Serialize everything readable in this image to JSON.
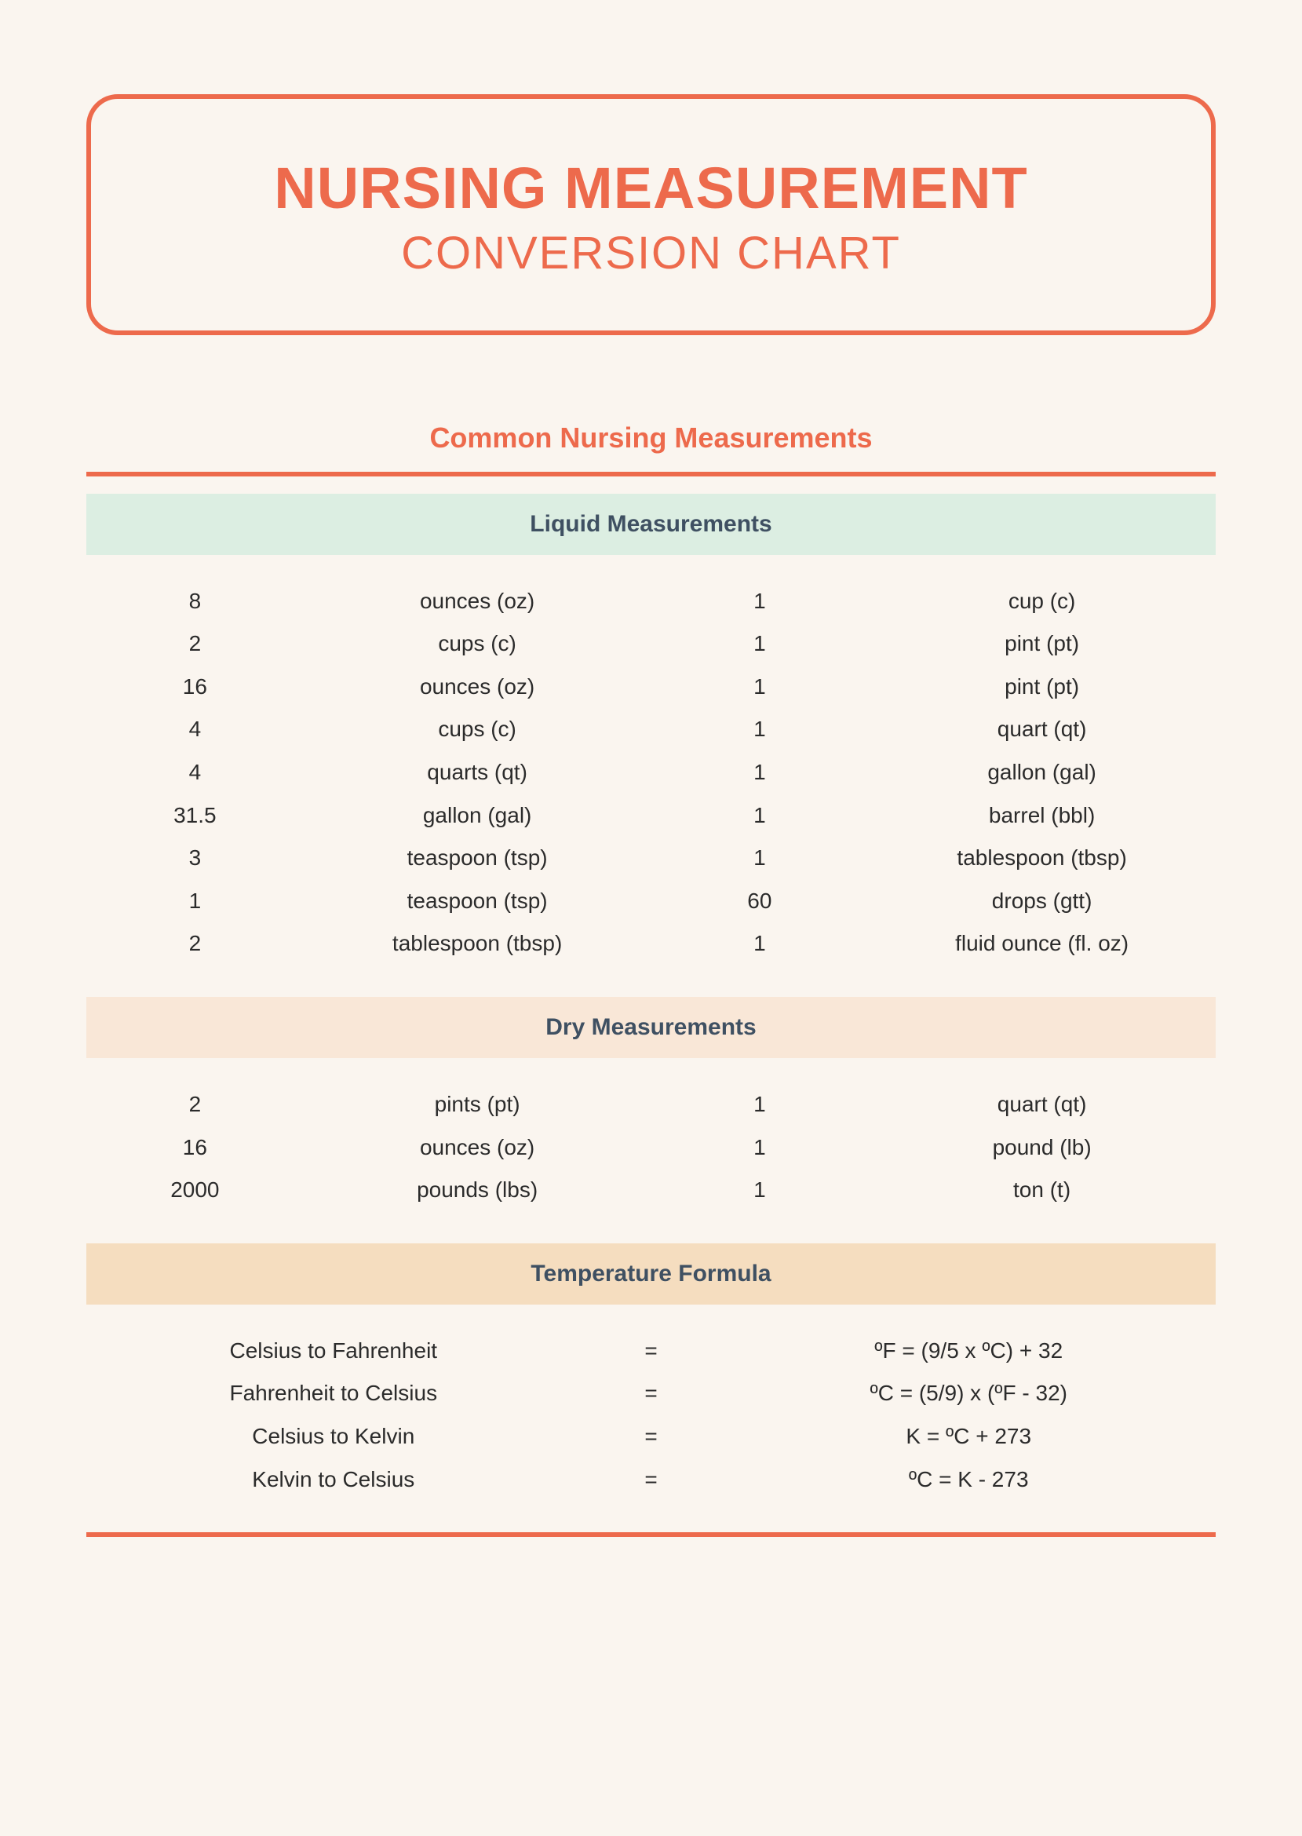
{
  "header": {
    "title_main": "NURSING MEASUREMENT",
    "title_sub": "CONVERSION CHART"
  },
  "section_heading": "Common Nursing Measurements",
  "sections": {
    "liquid": {
      "label": "Liquid Measurements",
      "rows": [
        {
          "a": "8",
          "au": "ounces (oz)",
          "b": "1",
          "bu": "cup (c)"
        },
        {
          "a": "2",
          "au": "cups (c)",
          "b": "1",
          "bu": "pint (pt)"
        },
        {
          "a": "16",
          "au": "ounces (oz)",
          "b": "1",
          "bu": "pint (pt)"
        },
        {
          "a": "4",
          "au": "cups (c)",
          "b": "1",
          "bu": "quart (qt)"
        },
        {
          "a": "4",
          "au": "quarts (qt)",
          "b": "1",
          "bu": "gallon (gal)"
        },
        {
          "a": "31.5",
          "au": "gallon (gal)",
          "b": "1",
          "bu": "barrel (bbl)"
        },
        {
          "a": "3",
          "au": "teaspoon (tsp)",
          "b": "1",
          "bu": "tablespoon (tbsp)"
        },
        {
          "a": "1",
          "au": "teaspoon (tsp)",
          "b": "60",
          "bu": "drops (gtt)"
        },
        {
          "a": "2",
          "au": "tablespoon (tbsp)",
          "b": "1",
          "bu": "fluid ounce (fl. oz)"
        }
      ]
    },
    "dry": {
      "label": "Dry Measurements",
      "rows": [
        {
          "a": "2",
          "au": "pints (pt)",
          "b": "1",
          "bu": "quart (qt)"
        },
        {
          "a": "16",
          "au": "ounces (oz)",
          "b": "1",
          "bu": "pound (lb)"
        },
        {
          "a": "2000",
          "au": "pounds (lbs)",
          "b": "1",
          "bu": "ton (t)"
        }
      ]
    },
    "temperature": {
      "label": "Temperature Formula",
      "rows": [
        {
          "name": "Celsius to Fahrenheit",
          "eq": "=",
          "formula": "ºF = (9/5 x ºC) + 32"
        },
        {
          "name": "Fahrenheit to Celsius",
          "eq": "=",
          "formula": "ºC = (5/9) x (ºF - 32)"
        },
        {
          "name": "Celsius to Kelvin",
          "eq": "=",
          "formula": "K = ºC + 273"
        },
        {
          "name": "Kelvin to Celsius",
          "eq": "=",
          "formula": "ºC = K - 273"
        }
      ]
    }
  }
}
